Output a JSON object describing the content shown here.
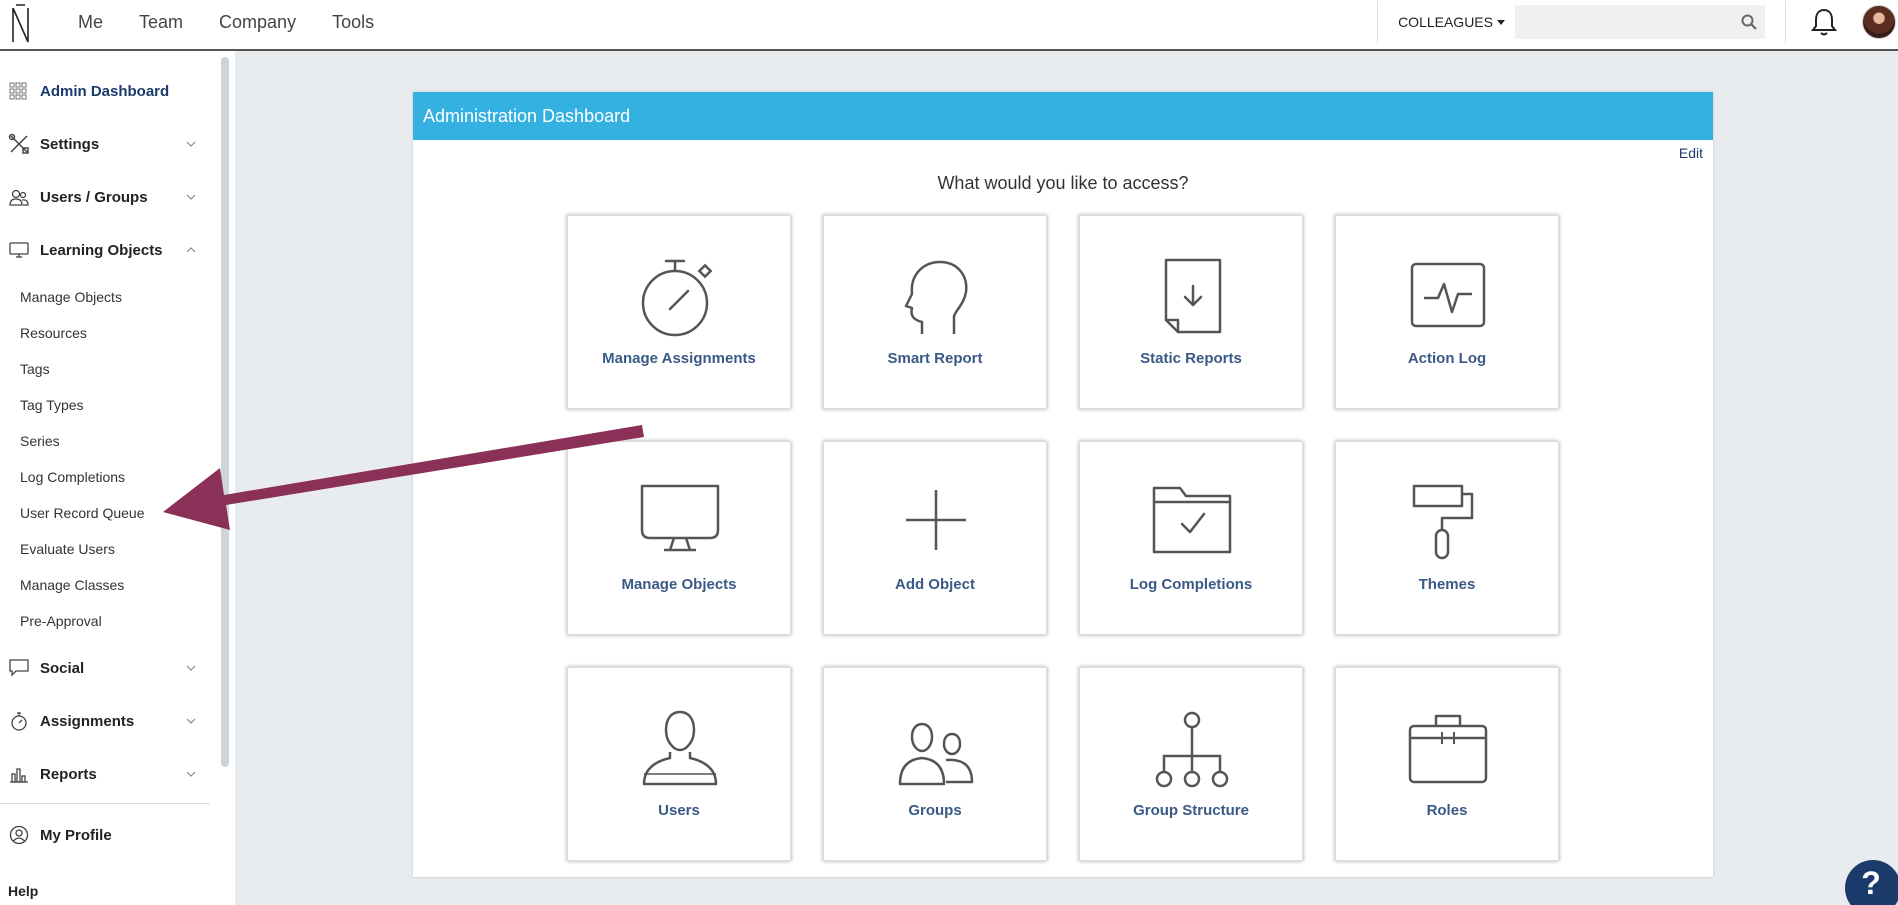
{
  "topnav": {
    "items": [
      "Me",
      "Team",
      "Company",
      "Tools"
    ]
  },
  "header": {
    "colleagues_label": "COLLEAGUES",
    "search_placeholder": ""
  },
  "sidebar": {
    "admin_dashboard": "Admin Dashboard",
    "settings": "Settings",
    "users_groups": "Users / Groups",
    "learning_objects": "Learning Objects",
    "learning_objects_items": [
      "Manage Objects",
      "Resources",
      "Tags",
      "Tag Types",
      "Series",
      "Log Completions",
      "User Record Queue",
      "Evaluate Users",
      "Manage Classes",
      "Pre-Approval"
    ],
    "social": "Social",
    "assignments": "Assignments",
    "reports": "Reports",
    "my_profile": "My Profile",
    "help": "Help"
  },
  "panel": {
    "title": "Administration Dashboard",
    "edit_label": "Edit",
    "question": "What would you like to access?",
    "tiles": [
      {
        "label": "Manage Assignments",
        "icon": "stopwatch-icon"
      },
      {
        "label": "Smart Report",
        "icon": "head-icon"
      },
      {
        "label": "Static Reports",
        "icon": "document-download-icon"
      },
      {
        "label": "Action Log",
        "icon": "pulse-monitor-icon"
      },
      {
        "label": "Manage Objects",
        "icon": "monitor-icon"
      },
      {
        "label": "Add Object",
        "icon": "plus-icon"
      },
      {
        "label": "Log Completions",
        "icon": "folder-check-icon"
      },
      {
        "label": "Themes",
        "icon": "paint-roller-icon"
      },
      {
        "label": "Users",
        "icon": "user-icon"
      },
      {
        "label": "Groups",
        "icon": "group-icon"
      },
      {
        "label": "Group Structure",
        "icon": "hierarchy-icon"
      },
      {
        "label": "Roles",
        "icon": "briefcase-icon"
      }
    ]
  },
  "help_button": "?",
  "colors": {
    "accent": "#34b0e1",
    "navy": "#1b3c6b",
    "tile_label": "#3a5a86",
    "arrow": "#8b3158"
  }
}
